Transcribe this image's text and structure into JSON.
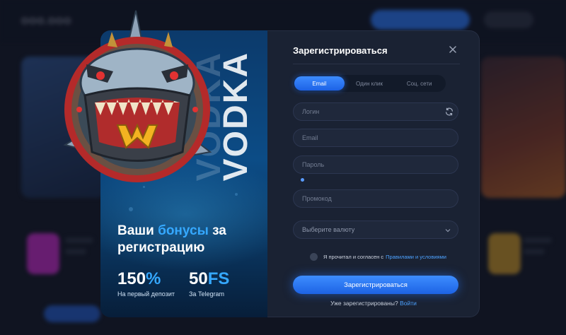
{
  "background": {
    "logo": "ООО.ООО"
  },
  "promo": {
    "brand": "VODKA",
    "title_part1": "Ваши ",
    "title_accent": "бонусы",
    "title_part2": " за регистрацию",
    "stats": [
      {
        "value": "150",
        "unit": "%",
        "label": "На первый депозит"
      },
      {
        "value": "50",
        "unit": "FS",
        "label": "За Telegram"
      }
    ]
  },
  "form": {
    "title": "Зарегистрироваться",
    "tabs": [
      {
        "label": "Email",
        "active": true
      },
      {
        "label": "Один клик",
        "active": false
      },
      {
        "label": "Соц. сети",
        "active": false
      }
    ],
    "fields": {
      "login_placeholder": "Логин",
      "email_placeholder": "Email",
      "password_placeholder": "Пароль",
      "promo_placeholder": "Промокод"
    },
    "currency_placeholder": "Выберите валюту",
    "agree_text": "Я прочитал и согласен с",
    "agree_link": "Правилами и условиями",
    "submit_label": "Зарегистрироваться",
    "already_text": "Уже зарегистрированы?",
    "login_link": "Войти"
  },
  "colors": {
    "accent": "#35a8ff",
    "primary_button": "#2a72f0",
    "panel_bg": "#1a2233"
  }
}
